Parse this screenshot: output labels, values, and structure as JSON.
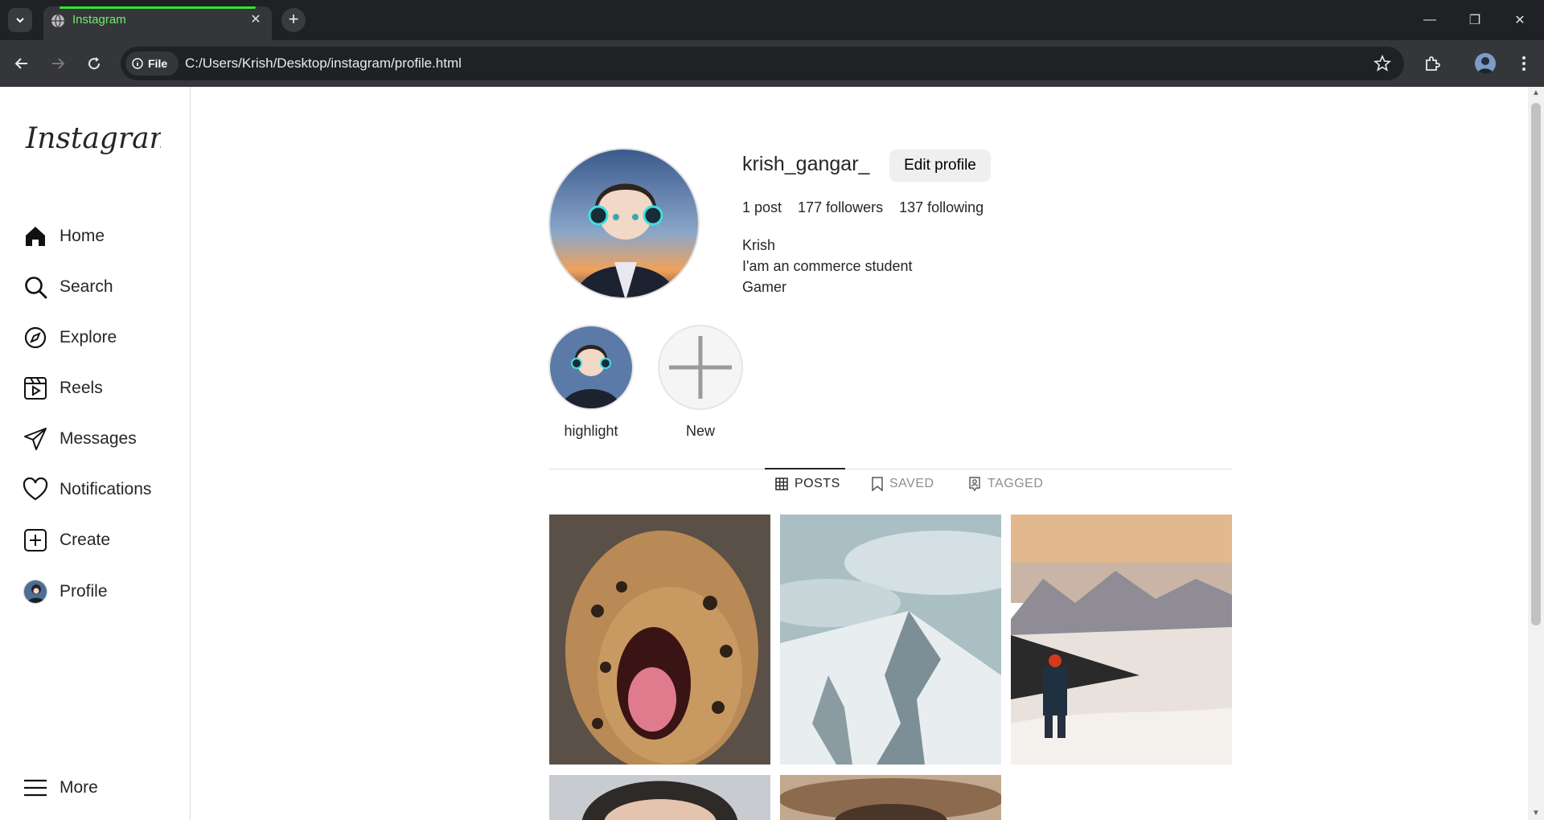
{
  "browser": {
    "tab_title": "Instagram",
    "url_chip": "File",
    "url": "C:/Users/Krish/Desktop/instagram/profile.html"
  },
  "sidebar": {
    "logo_text": "Instagram",
    "items": [
      {
        "label": "Home",
        "icon": "home-icon"
      },
      {
        "label": "Search",
        "icon": "search-icon"
      },
      {
        "label": "Explore",
        "icon": "compass-icon"
      },
      {
        "label": "Reels",
        "icon": "reels-icon"
      },
      {
        "label": "Messages",
        "icon": "send-icon"
      },
      {
        "label": "Notifications",
        "icon": "heart-icon"
      },
      {
        "label": "Create",
        "icon": "plus-square-icon"
      },
      {
        "label": "Profile",
        "icon": "avatar"
      }
    ],
    "more_label": "More"
  },
  "profile": {
    "username": "krish_gangar_",
    "edit_label": "Edit profile",
    "stats": {
      "posts": "1 post",
      "followers": "177 followers",
      "following": "137 following"
    },
    "bio": {
      "name": "Krish",
      "line1": "I'am an commerce student",
      "line2": "Gamer"
    }
  },
  "highlights": [
    {
      "label": "highlight"
    },
    {
      "label": "New"
    }
  ],
  "tabs": [
    {
      "label": "POSTS",
      "active": true
    },
    {
      "label": "SAVED",
      "active": false
    },
    {
      "label": "TAGGED",
      "active": false
    }
  ],
  "posts": [
    {
      "subject": "leopard-yawning-photo"
    },
    {
      "subject": "snowy-mountain-photo"
    },
    {
      "subject": "hiker-on-snowy-hill-photo"
    },
    {
      "subject": "man-portrait-photo"
    },
    {
      "subject": "person-with-hat-photo"
    }
  ],
  "colors": {
    "tab_accent": "#2ee62e",
    "text": "#262626",
    "button_bg": "#efefef"
  }
}
